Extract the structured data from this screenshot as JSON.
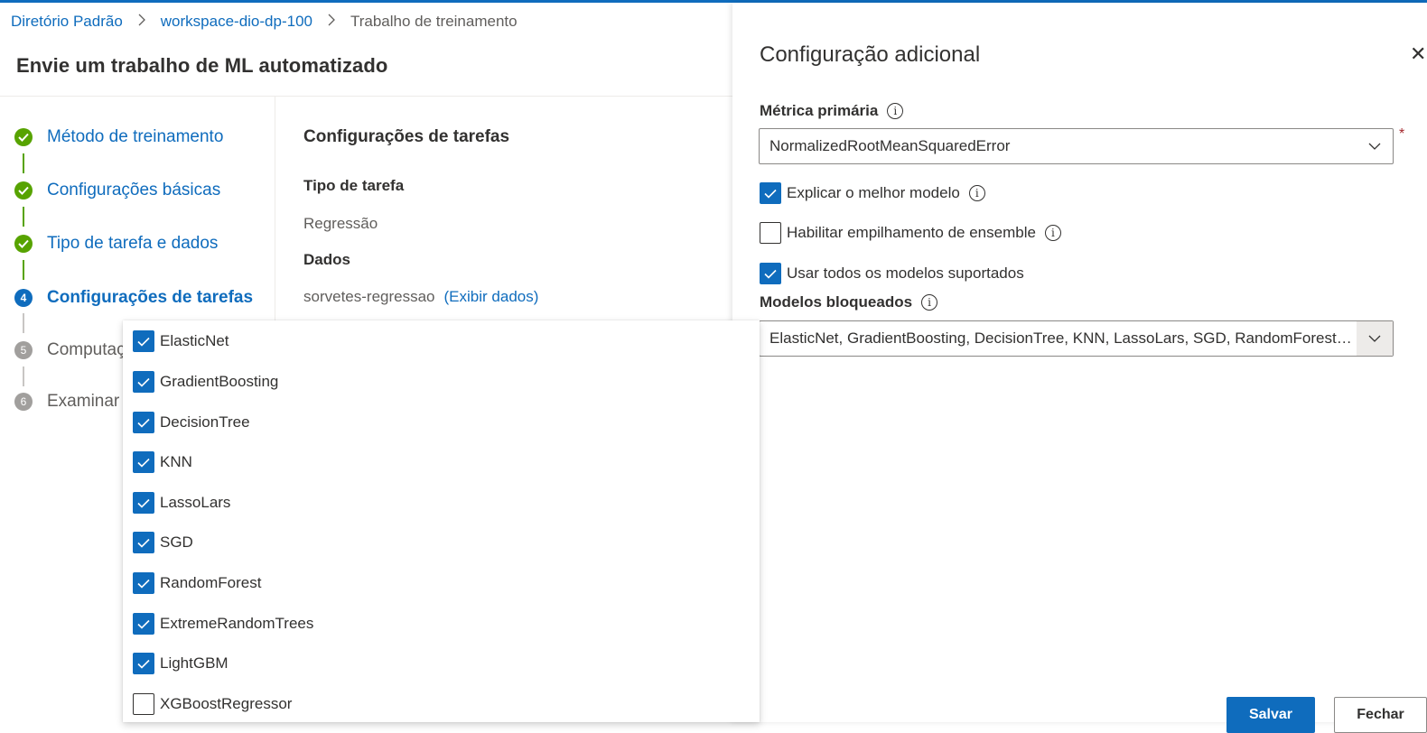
{
  "breadcrumb": {
    "items": [
      "Diretório Padrão",
      "workspace-dio-dp-100"
    ],
    "current": "Trabalho de treinamento"
  },
  "page_title": "Envie um trabalho de ML automatizado",
  "wizard": {
    "steps": [
      {
        "number": "1",
        "label": "Método de treinamento",
        "state": "done"
      },
      {
        "number": "2",
        "label": "Configurações básicas",
        "state": "done"
      },
      {
        "number": "3",
        "label": "Tipo de tarefa e dados",
        "state": "done"
      },
      {
        "number": "4",
        "label": "Configurações de tarefas",
        "state": "current"
      },
      {
        "number": "5",
        "label": "Computação",
        "state": "pending"
      },
      {
        "number": "6",
        "label": "Examinar",
        "state": "pending"
      }
    ]
  },
  "task_settings": {
    "title": "Configurações de tarefas",
    "task_type_label": "Tipo de tarefa",
    "task_type_value": "Regressão",
    "data_label": "Dados",
    "data_value": "sorvetes-regressao",
    "view_data_link": "(Exibir dados)"
  },
  "blocked_models_options": [
    {
      "label": "ElasticNet",
      "checked": true
    },
    {
      "label": "GradientBoosting",
      "checked": true
    },
    {
      "label": "DecisionTree",
      "checked": true
    },
    {
      "label": "KNN",
      "checked": true
    },
    {
      "label": "LassoLars",
      "checked": true
    },
    {
      "label": "SGD",
      "checked": true
    },
    {
      "label": "RandomForest",
      "checked": true
    },
    {
      "label": "ExtremeRandomTrees",
      "checked": true
    },
    {
      "label": "LightGBM",
      "checked": true
    },
    {
      "label": "XGBoostRegressor",
      "checked": false
    }
  ],
  "panel": {
    "title": "Configuração adicional",
    "close_icon": "✕",
    "primary_metric_label": "Métrica primária",
    "primary_metric_value": "NormalizedRootMeanSquaredError",
    "required_mark": "*",
    "explain_best_label": "Explicar o melhor modelo",
    "explain_best_checked": true,
    "ensemble_label": "Habilitar empilhamento de ensemble",
    "ensemble_checked": false,
    "use_all_label": "Usar todos os modelos suportados",
    "use_all_checked": true,
    "blocked_models_label": "Modelos bloqueados",
    "blocked_models_value": "ElasticNet, GradientBoosting, DecisionTree, KNN, LassoLars, SGD, RandomForest, ExtremeRandomTrees, LightGBM",
    "save_button": "Salvar",
    "close_button": "Fechar"
  },
  "colors": {
    "accent": "#0f6cbd",
    "success": "#57a300",
    "pending": "#a19f9d"
  }
}
